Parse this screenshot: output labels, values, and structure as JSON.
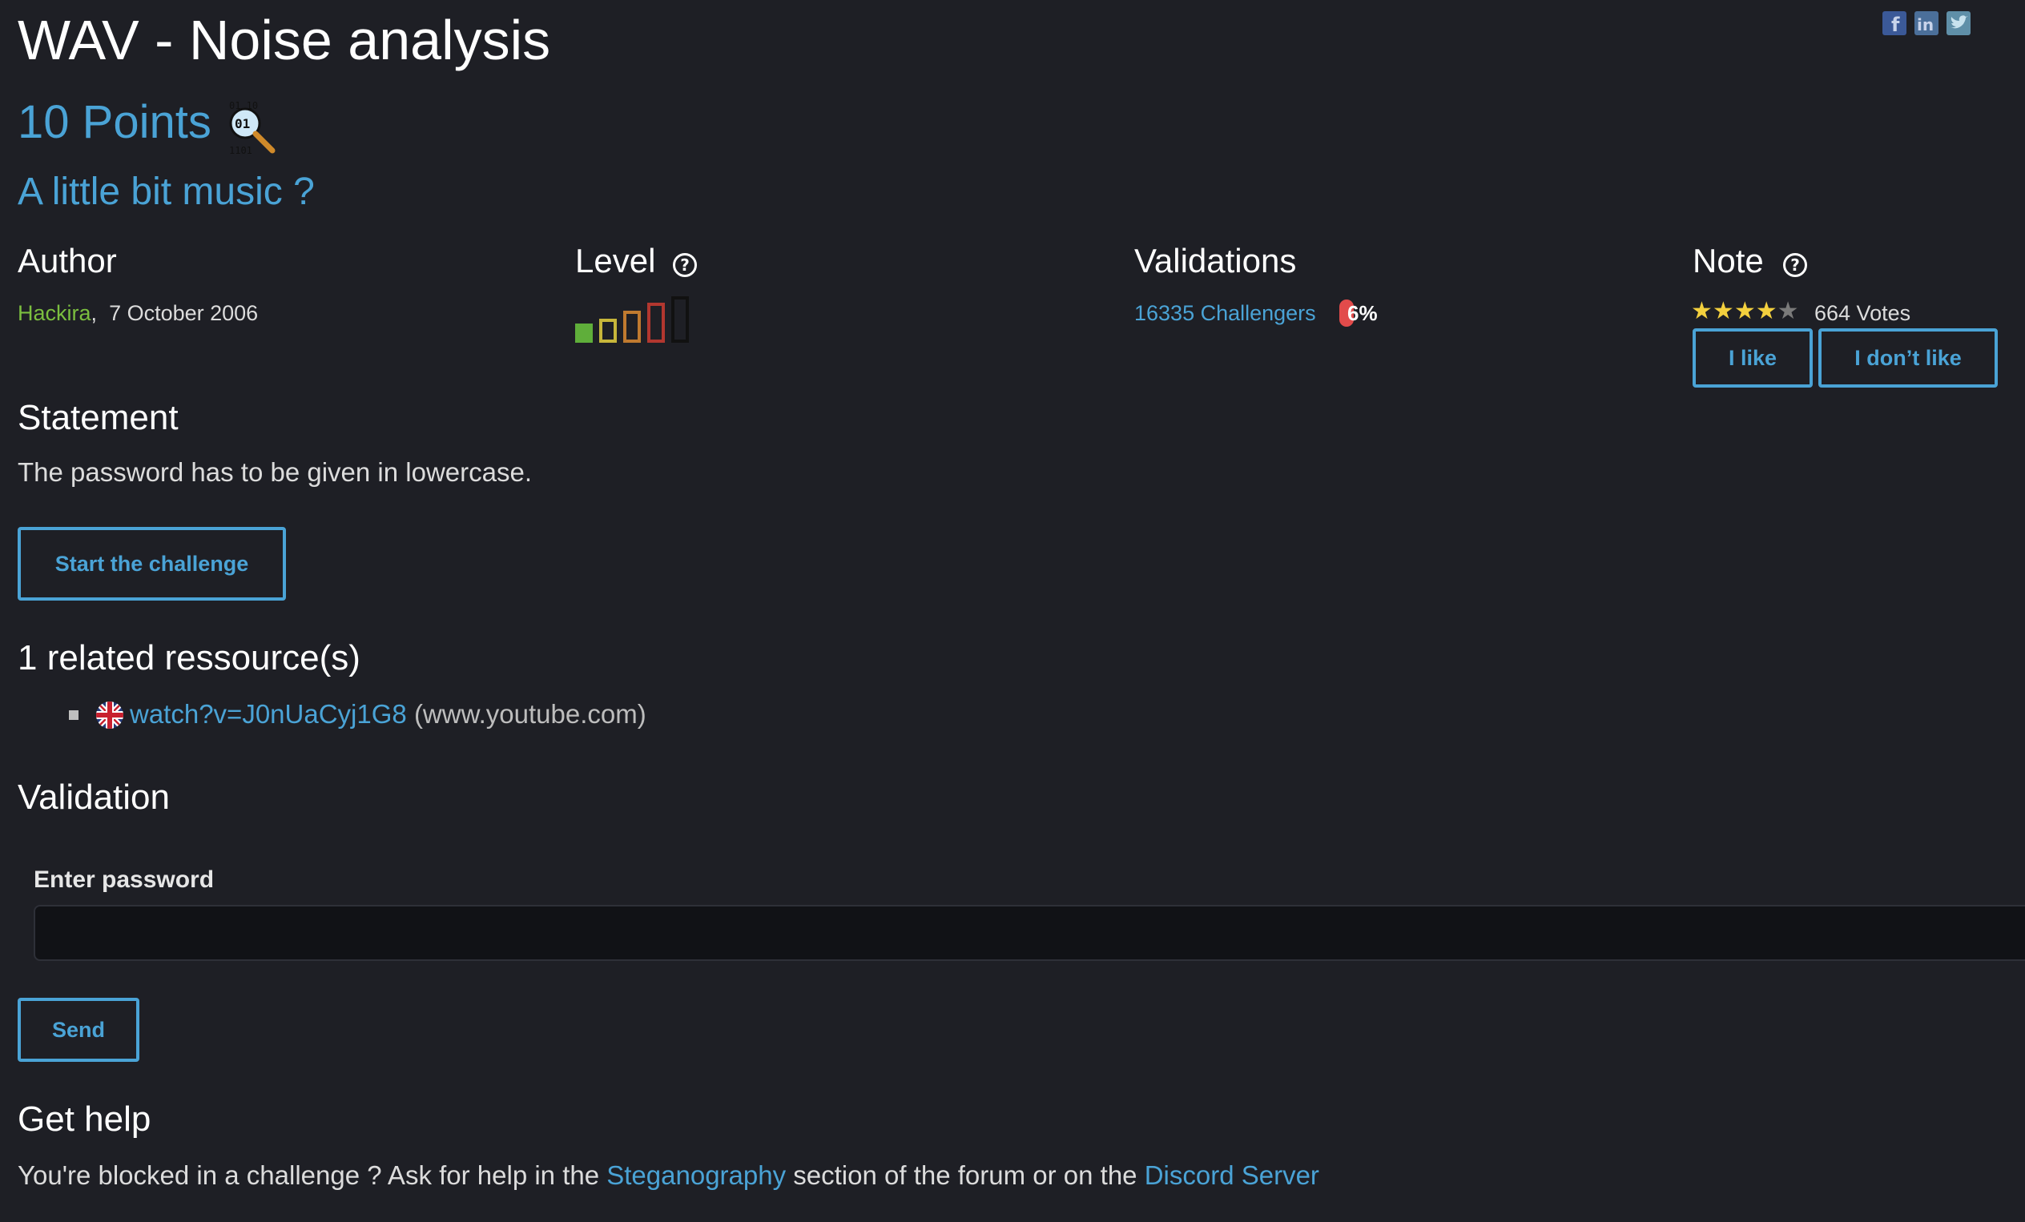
{
  "header": {
    "title": "WAV - Noise analysis",
    "points": "10 Points",
    "category_icon": "magnifier-binary-icon",
    "subtitle": "A little bit music ?",
    "social": [
      "facebook-icon",
      "linkedin-icon",
      "twitter-icon"
    ]
  },
  "info": {
    "author_heading": "Author",
    "author_name": "Hackira",
    "author_sep": ",",
    "author_date": "7 October 2006",
    "level_heading": "Level",
    "level_value": 1,
    "level_max": 5,
    "validations_heading": "Validations",
    "challengers": "16335 Challengers",
    "percent": "6%",
    "note_heading": "Note",
    "stars": 4,
    "stars_max": 5,
    "votes": "664 Votes",
    "like_label": "I like",
    "dislike_label": "I don’t like"
  },
  "statement": {
    "heading": "Statement",
    "text": "The password has to be given in lowercase.",
    "start_label": "Start the challenge"
  },
  "resources": {
    "heading": "1 related ressource(s)",
    "items": [
      {
        "link": "watch?v=J0nUaCyj1G8",
        "domain": "(www.youtube.com)",
        "flag": "uk-flag-icon"
      }
    ]
  },
  "validation": {
    "heading": "Validation",
    "label": "Enter password",
    "value": "",
    "send_label": "Send"
  },
  "help": {
    "heading": "Get help",
    "text_before": "You're blocked in a challenge ? Ask for help in the ",
    "link1": "Steganography",
    "text_middle": " section of the forum or on the ",
    "link2": "Discord Server"
  },
  "colors": {
    "background": "#1e1f25",
    "accent": "#4aa3d6",
    "author": "#7bbf3f",
    "star": "#f3d03e",
    "badge": "#e24b4b"
  }
}
